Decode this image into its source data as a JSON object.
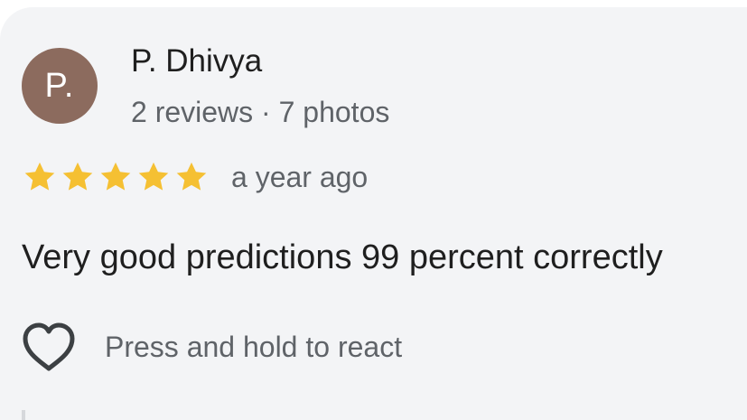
{
  "review": {
    "author": {
      "initials": "P.",
      "name": "P. Dhivya",
      "meta": "2 reviews · 7 photos",
      "avatar_color": "#8c6b5e"
    },
    "rating": {
      "value": 5,
      "max": 5,
      "star_color": "#f5c033",
      "icon": "star-icon"
    },
    "date": "a year ago",
    "text": "Very good predictions 99 percent correctly",
    "reaction": {
      "icon": "heart-outline-icon",
      "label": "Press and hold to react"
    }
  }
}
